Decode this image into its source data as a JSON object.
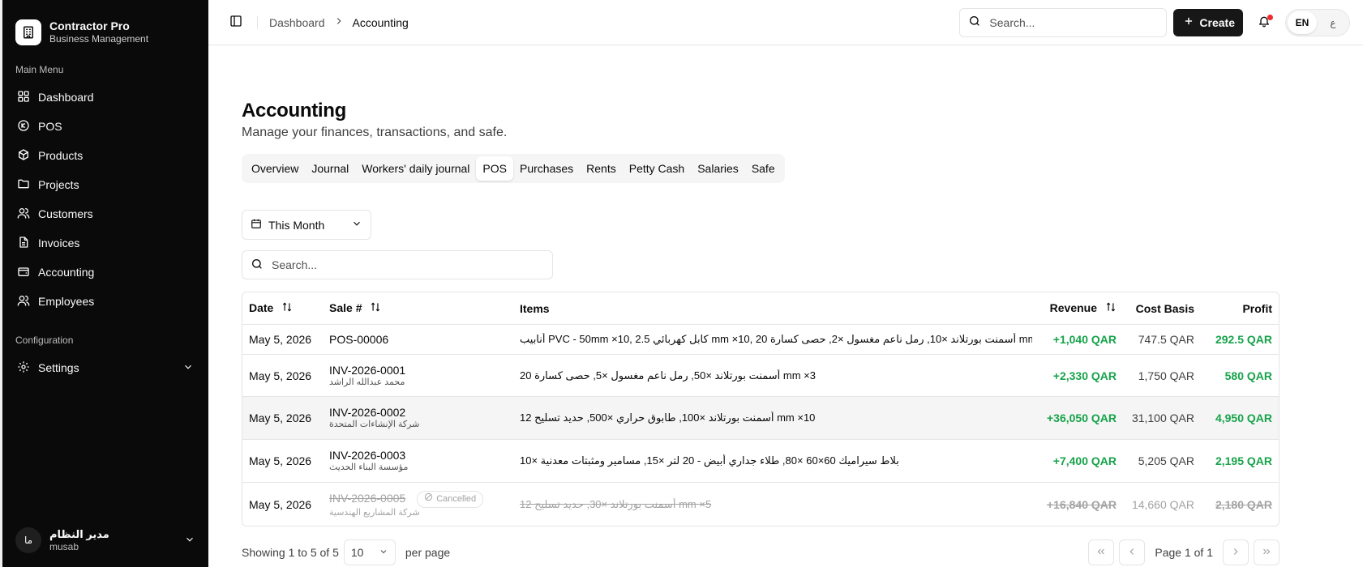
{
  "brand": {
    "title": "Contractor Pro",
    "subtitle": "Business Management"
  },
  "sidebar": {
    "main_menu_label": "Main Menu",
    "items": [
      {
        "label": "Dashboard",
        "icon": "layout-grid-icon"
      },
      {
        "label": "POS",
        "icon": "pos-icon"
      },
      {
        "label": "Products",
        "icon": "box-icon"
      },
      {
        "label": "Projects",
        "icon": "folder-icon"
      },
      {
        "label": "Customers",
        "icon": "users-icon"
      },
      {
        "label": "Invoices",
        "icon": "file-icon"
      },
      {
        "label": "Accounting",
        "icon": "wallet-icon"
      },
      {
        "label": "Employees",
        "icon": "user-group-icon"
      }
    ],
    "config_label": "Configuration",
    "settings_label": "Settings",
    "user": {
      "initials": "ما",
      "name": "مدير النظام",
      "handle": "musab"
    }
  },
  "header": {
    "breadcrumb": [
      "Dashboard",
      "Accounting"
    ],
    "search_placeholder": "Search...",
    "create_label": "Create",
    "lang_active": "EN",
    "lang_other": "ع",
    "notification_dot_color": "#ef2b2b"
  },
  "page": {
    "title": "Accounting",
    "subtitle": "Manage your finances, transactions, and safe.",
    "tabs": [
      "Overview",
      "Journal",
      "Workers' daily journal",
      "POS",
      "Purchases",
      "Rents",
      "Petty Cash",
      "Salaries",
      "Safe"
    ],
    "active_tab": "POS",
    "period": "This Month",
    "table_search_placeholder": "Search..."
  },
  "table": {
    "headers": {
      "date": "Date",
      "sale": "Sale #",
      "items": "Items",
      "revenue": "Revenue",
      "cost": "Cost Basis",
      "profit": "Profit"
    },
    "rows": [
      {
        "date": "May 5, 2026",
        "sale": "POS-00006",
        "customer": "",
        "items": "أنابيب PVC - 50mm ×10, 2.5 كابل كهربائي mm ×10, 20 أسمنت بورتلاند ×10, رمل ناعم مغسول ×2, حصى كسارة mm ×3",
        "revenue": "+1,040 QAR",
        "cost": "747.5 QAR",
        "profit": "292.5 QAR",
        "status": ""
      },
      {
        "date": "May 5, 2026",
        "sale": "INV-2026-0001",
        "customer": "محمد عبدالله الراشد",
        "items": "أسمنت بورتلاند ×50, رمل ناعم مغسول ×5, حصى كسارة 20 mm ×3",
        "revenue": "+2,330 QAR",
        "cost": "1,750 QAR",
        "profit": "580 QAR",
        "status": ""
      },
      {
        "date": "May 5, 2026",
        "sale": "INV-2026-0002",
        "customer": "شركة الإنشاءات المتحدة",
        "items": "أسمنت بورتلاند ×100, طابوق حراري ×500, حديد تسليح 12 mm ×10",
        "revenue": "+36,050 QAR",
        "cost": "31,100 QAR",
        "profit": "4,950 QAR",
        "status": ""
      },
      {
        "date": "May 5, 2026",
        "sale": "INV-2026-0003",
        "customer": "مؤسسة البناء الحديث",
        "items": "بلاط سيراميك 60×60 ×80, طلاء جداري أبيض - 20 لتر ×15, مسامير ومثبتات معدنية ×10",
        "revenue": "+7,400 QAR",
        "cost": "5,205 QAR",
        "profit": "2,195 QAR",
        "status": ""
      },
      {
        "date": "May 5, 2026",
        "sale": "INV-2026-0005",
        "customer": "شركة المشاريع الهندسية",
        "items": "أسمنت بورتلاند ×30, حديد تسليح 12 mm ×5",
        "revenue": "+16,840 QAR",
        "cost": "14,660 QAR",
        "profit": "2,180 QAR",
        "status": "Cancelled"
      }
    ]
  },
  "pagination": {
    "showing": "Showing 1 to 5 of 5",
    "per_page_value": "10",
    "per_page_label": "per page",
    "page_info": "Page 1 of 1"
  },
  "colors": {
    "positive": "#16a34a",
    "sidebar_bg": "#0a0a0a",
    "primary_button": "#171717"
  }
}
